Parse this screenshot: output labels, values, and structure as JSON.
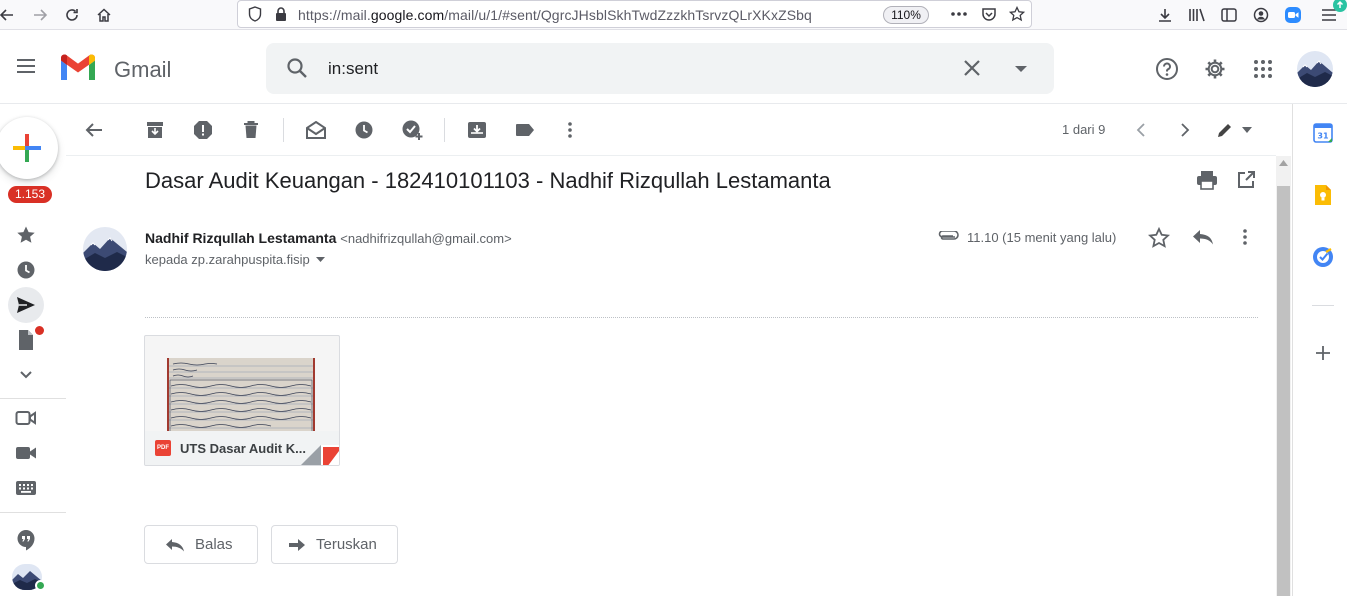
{
  "browser": {
    "url_prefix": "https://mail.",
    "url_domain": "google.com",
    "url_rest": "/mail/u/1/#sent/QgrcJHsblSkhTwdZzzkhTsrvzQLrXKxZSbq",
    "zoom": "110%"
  },
  "app": {
    "name": "Gmail",
    "search_query": "in:sent"
  },
  "sidebar": {
    "inbox_count": "1.153"
  },
  "toolbar": {
    "pager": "1 dari 9"
  },
  "message": {
    "subject": "Dasar Audit Keuangan - 182410101103 - Nadhif Rizqullah Lestamanta",
    "sender_name": "Nadhif Rizqullah Lestamanta",
    "sender_email": "<nadhifrizqullah@gmail.com>",
    "recipient": "kepada zp.zarahpuspita.fisip",
    "time": "11.10 (15 menit yang lalu)"
  },
  "attachment": {
    "type_label": "PDF",
    "name": "UTS Dasar Audit K..."
  },
  "actions": {
    "reply_label": "Balas",
    "forward_label": "Teruskan"
  },
  "colors": {
    "gmail_red": "#ea4335",
    "badge_red": "#d93025",
    "google_blue": "#4285f4",
    "google_yellow": "#fbbc04",
    "google_green": "#34a853"
  }
}
